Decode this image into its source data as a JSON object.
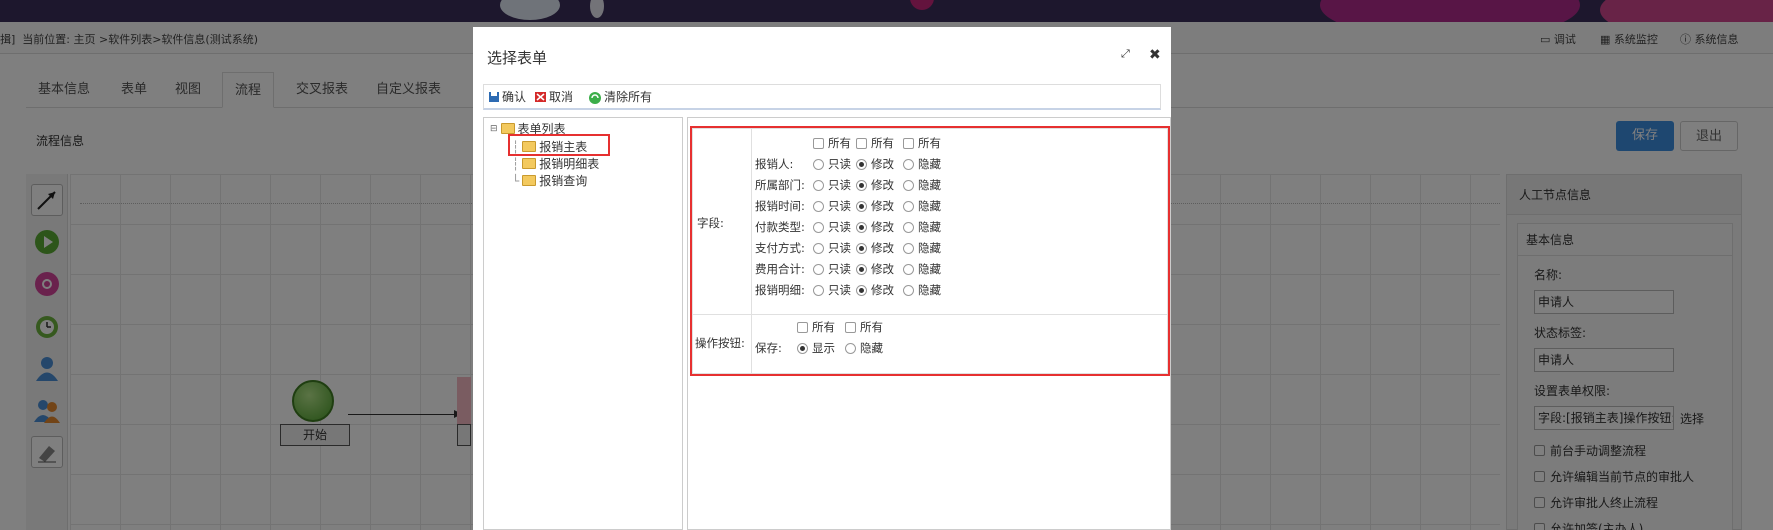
{
  "breadcrumb": {
    "prefix": "揖]",
    "text": "当前位置: 主页 >软件列表>软件信息(测试系统)"
  },
  "top_links": {
    "debug": "调试",
    "monitor": "系统监控",
    "info": "系统信息"
  },
  "tabs": [
    "基本信息",
    "表单",
    "视图",
    "流程",
    "交叉报表",
    "自定义报表"
  ],
  "flow_info_label": "流程信息",
  "buttons": {
    "save": "保存",
    "exit": "退出"
  },
  "canvas": {
    "start_label": "开始"
  },
  "right_panel": {
    "title": "人工节点信息",
    "box_title": "基本信息",
    "name_label": "名称:",
    "name_value": "申请人",
    "status_label": "状态标签:",
    "status_value": "申请人",
    "perm_label": "设置表单权限:",
    "perm_value": "字段:[报销主表]操作按钮:[",
    "select_link": "选择",
    "checks": [
      "前台手动调整流程",
      "允许编辑当前节点的审批人",
      "允许审批人终止流程",
      "允许加签(主办人)"
    ]
  },
  "dialog": {
    "title": "选择表单",
    "toolbar": {
      "confirm": "确认",
      "cancel": "取消",
      "clear": "清除所有"
    },
    "tree": {
      "root": "表单列表",
      "items": [
        "报销主表",
        "报销明细表",
        "报销查询"
      ]
    },
    "fields_label": "字段:",
    "all_label": "所有",
    "options": [
      "只读",
      "修改",
      "隐藏"
    ],
    "fields": [
      "报销人:",
      "所属部门:",
      "报销时间:",
      "付款类型:",
      "支付方式:",
      "费用合计:",
      "报销明细:"
    ],
    "buttons_label": "操作按钮:",
    "button_row": "保存:",
    "button_options": [
      "显示",
      "隐藏"
    ]
  },
  "colors": {
    "accent": "#3d8ee0",
    "highlight": "#e63030",
    "banner": "#3a2f5a"
  }
}
